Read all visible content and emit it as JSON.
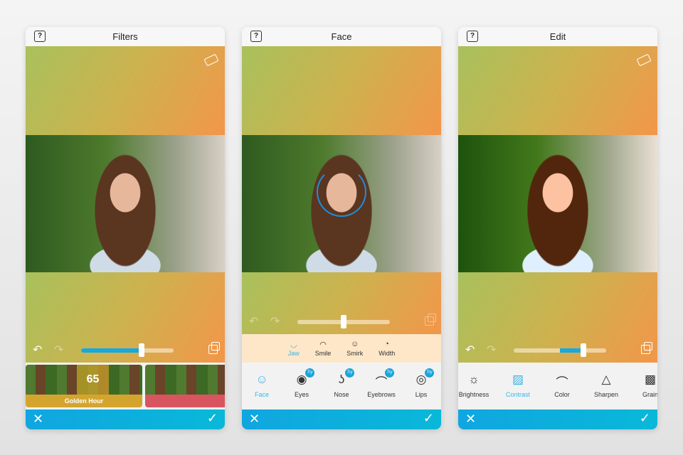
{
  "panels": [
    {
      "title": "Filters",
      "help": "?",
      "slider_percent": 65,
      "filters": [
        {
          "label": "Golden Hour",
          "value": "65",
          "color": "#d4a52e"
        },
        {
          "label": "",
          "color": "#d85560"
        }
      ]
    },
    {
      "title": "Face",
      "help": "?",
      "slider_percent": 50,
      "sub_tools": [
        {
          "icon": "jaw-icon",
          "label": "Jaw",
          "active": true
        },
        {
          "icon": "smile-icon",
          "label": "Smile"
        },
        {
          "icon": "smirk-icon",
          "label": "Smirk"
        },
        {
          "icon": "width-icon",
          "label": "Width"
        }
      ],
      "tools": [
        {
          "icon": "face-icon",
          "label": "Face",
          "active": true
        },
        {
          "icon": "eye-icon",
          "label": "Eyes",
          "badge": "Try"
        },
        {
          "icon": "nose-icon",
          "label": "Nose",
          "badge": "Try"
        },
        {
          "icon": "eyebrow-icon",
          "label": "Eyebrows",
          "badge": "Try"
        },
        {
          "icon": "lips-icon",
          "label": "Lips",
          "badge": "Try"
        }
      ]
    },
    {
      "title": "Edit",
      "help": "?",
      "slider_percent": 75,
      "tools": [
        {
          "icon": "brightness-icon",
          "label": "Brightness"
        },
        {
          "icon": "contrast-icon",
          "label": "Contrast",
          "active": true
        },
        {
          "icon": "color-icon",
          "label": "Color"
        },
        {
          "icon": "sharpen-icon",
          "label": "Sharpen"
        },
        {
          "icon": "grain-icon",
          "label": "Grain"
        }
      ]
    }
  ],
  "colors": {
    "accent": "#14a9e0"
  }
}
